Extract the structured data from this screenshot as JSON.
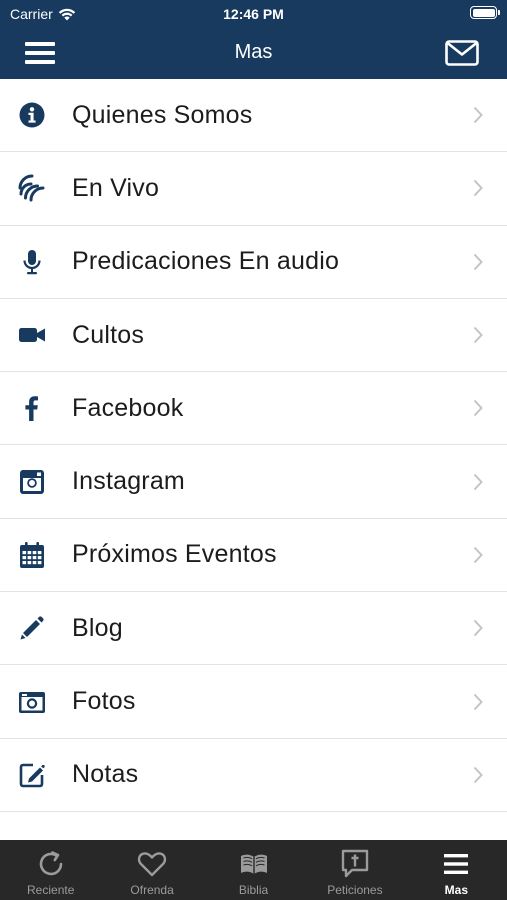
{
  "status_bar": {
    "carrier": "Carrier",
    "time": "12:46 PM"
  },
  "nav": {
    "title": "Mas"
  },
  "menu_items": [
    {
      "label": "Quienes Somos",
      "icon": "info-icon"
    },
    {
      "label": "En Vivo",
      "icon": "live-signal-icon"
    },
    {
      "label": "Predicaciones En audio",
      "icon": "microphone-icon"
    },
    {
      "label": "Cultos",
      "icon": "video-camera-icon"
    },
    {
      "label": "Facebook",
      "icon": "facebook-icon"
    },
    {
      "label": "Instagram",
      "icon": "instagram-icon"
    },
    {
      "label": "Próximos Eventos",
      "icon": "calendar-icon"
    },
    {
      "label": "Blog",
      "icon": "pencil-icon"
    },
    {
      "label": "Fotos",
      "icon": "photo-camera-icon"
    },
    {
      "label": "Notas",
      "icon": "edit-note-icon"
    }
  ],
  "tabs": [
    {
      "label": "Reciente",
      "icon": "refresh-icon",
      "active": false
    },
    {
      "label": "Ofrenda",
      "icon": "heart-icon",
      "active": false
    },
    {
      "label": "Biblia",
      "icon": "book-icon",
      "active": false
    },
    {
      "label": "Peticiones",
      "icon": "prayer-bubble-icon",
      "active": false
    },
    {
      "label": "Mas",
      "icon": "menu-icon",
      "active": true
    }
  ],
  "colors": {
    "brand": "#173a5e",
    "tabbar": "#282828",
    "text": "#1c1c1c"
  }
}
